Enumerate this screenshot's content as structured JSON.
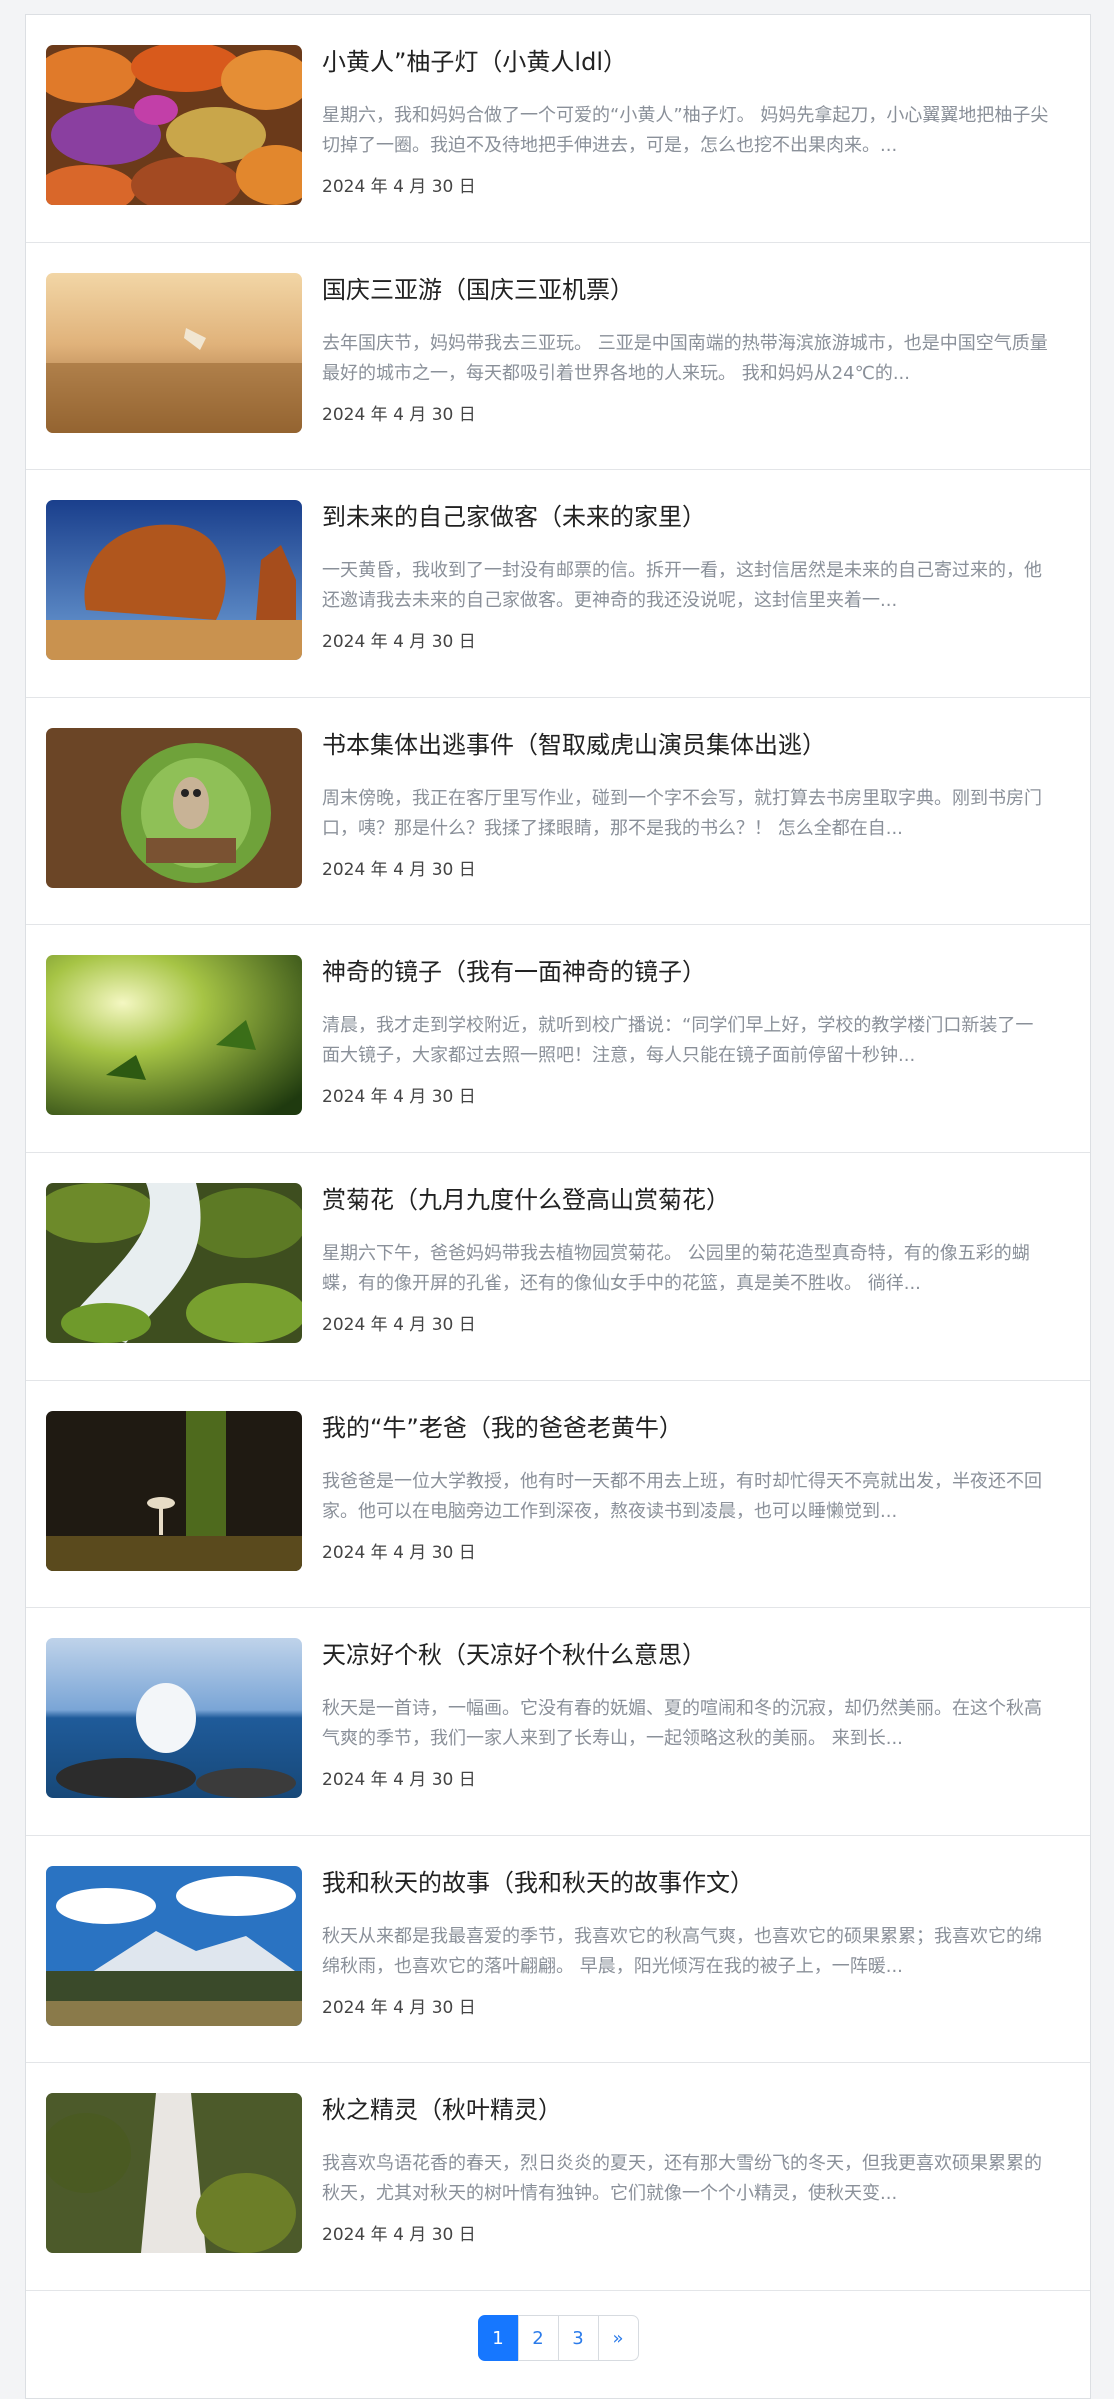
{
  "articles": [
    {
      "title": "小黄人”柚子灯（小黄人ldl）",
      "excerpt": "星期六，我和妈妈合做了一个可爱的“小黄人”柚子灯。 妈妈先拿起刀，小心翼翼地把柚子尖切掉了一圈。我迫不及待地把手伸进去，可是，怎么也挖不出果肉来。...",
      "date": "2024 年 4 月 30 日",
      "image": "pumpkins"
    },
    {
      "title": "国庆三亚游（国庆三亚机票）",
      "excerpt": "去年国庆节，妈妈带我去三亚玩。 三亚是中国南端的热带海滨旅游城市，也是中国空气质量最好的城市之一，每天都吸引着世界各地的人来玩。 我和妈妈从24℃的...",
      "date": "2024 年 4 月 30 日",
      "image": "bird-field"
    },
    {
      "title": "到未来的自己家做客（未来的家里）",
      "excerpt": "一天黄昏，我收到了一封没有邮票的信。拆开一看，这封信居然是未来的自己寄过来的，他还邀请我去未来的自己家做客。更神奇的我还没说呢，这封信里夹着一...",
      "date": "2024 年 4 月 30 日",
      "image": "desert-rock"
    },
    {
      "title": "书本集体出逃事件（智取威虎山演员集体出逃）",
      "excerpt": "周末傍晚，我正在客厅里写作业，碰到一个字不会写，就打算去书房里取字典。刚到书房门口，咦？那是什么？我揉了揉眼睛，那不是我的书么？！ 怎么全都在自...",
      "date": "2024 年 4 月 30 日",
      "image": "owl"
    },
    {
      "title": "神奇的镜子（我有一面神奇的镜子）",
      "excerpt": "清晨，我才走到学校附近，就听到校广播说：“同学们早上好，学校的教学楼门口新装了一面大镜子，大家都过去照一照吧！注意，每人只能在镜子面前停留十秒钟...",
      "date": "2024 年 4 月 30 日",
      "image": "green-leaves"
    },
    {
      "title": "赏菊花（九月九度什么登高山赏菊花）",
      "excerpt": "星期六下午，爸爸妈妈带我去植物园赏菊花。 公园里的菊花造型真奇特，有的像五彩的蝴蝶，有的像开屏的孔雀，还有的像仙女手中的花篮，真是美不胜收。 徜徉...",
      "date": "2024 年 4 月 30 日",
      "image": "mossy-stream"
    },
    {
      "title": "我的“牛”老爸（我的爸爸老黄牛）",
      "excerpt": "我爸爸是一位大学教授，他有时一天都不用去上班，有时却忙得天不亮就出发，半夜还不回家。他可以在电脑旁边工作到深夜，熬夜读书到凌晨，也可以睡懒觉到...",
      "date": "2024 年 4 月 30 日",
      "image": "mushroom"
    },
    {
      "title": "天凉好个秋（天凉好个秋什么意思）",
      "excerpt": "秋天是一首诗，一幅画。它没有春的妩媚、夏的喧闹和冬的沉寂，却仍然美丽。在这个秋高气爽的季节，我们一家人来到了长寿山，一起领略这秋的美丽。 来到长...",
      "date": "2024 年 4 月 30 日",
      "image": "wave"
    },
    {
      "title": "我和秋天的故事（我和秋天的故事作文）",
      "excerpt": "秋天从来都是我最喜爱的季节，我喜欢它的秋高气爽，也喜欢它的硕果累累；我喜欢它的绵绵秋雨，也喜欢它的落叶翩翩。 早晨，阳光倾泻在我的被子上，一阵暖...",
      "date": "2024 年 4 月 30 日",
      "image": "mountain-lake"
    },
    {
      "title": "秋之精灵（秋叶精灵）",
      "excerpt": "我喜欢鸟语花香的春天，烈日炎炎的夏天，还有那大雪纷飞的冬天，但我更喜欢硕果累累的秋天，尤其对秋天的树叶情有独钟。它们就像一个个小精灵，使秋天变...",
      "date": "2024 年 4 月 30 日",
      "image": "waterfall"
    }
  ],
  "pagination": {
    "pages": [
      "1",
      "2",
      "3"
    ],
    "active": "1",
    "next": "»"
  }
}
